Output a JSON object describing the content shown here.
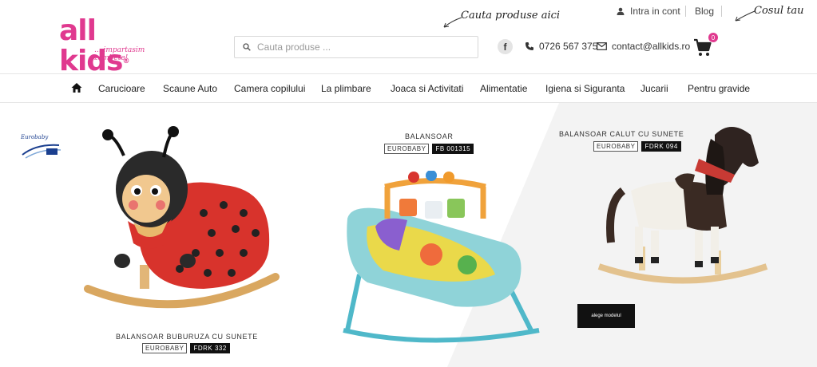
{
  "header": {
    "logo_text": "all kids",
    "logo_tagline": "... impartasim zambete!",
    "hint_search": "Cauta produse aici",
    "hint_cart": "Cosul tau",
    "search_placeholder": "Cauta produse ...",
    "login_label": "Intra in cont",
    "blog_label": "Blog",
    "phone": "0726 567 375",
    "email": "contact@allkids.ro",
    "cart_count": "0",
    "facebook_label": "f"
  },
  "nav": {
    "items": [
      "Carucioare",
      "Scaune Auto",
      "Camera copilului",
      "La plimbare",
      "Joaca si Activitati",
      "Alimentatie",
      "Igiena si Siguranta",
      "Jucarii",
      "Pentru gravide"
    ]
  },
  "hero": {
    "brand_badge": "Eurobaby",
    "products": [
      {
        "title": "BALANSOAR BUBURUZA CU SUNETE",
        "brand": "EUROBABY",
        "code": "FDRK 332"
      },
      {
        "title": "BALANSOAR",
        "brand": "EUROBABY",
        "code": "FB 001315"
      },
      {
        "title": "BALANSOAR CALUT CU SUNETE",
        "brand": "EUROBABY",
        "code": "FDRK 094"
      }
    ],
    "cta_label": "alege modelul"
  },
  "colors": {
    "brand_pink": "#e0398f",
    "hero_bg": "#f3f3f3",
    "dark": "#111111"
  }
}
